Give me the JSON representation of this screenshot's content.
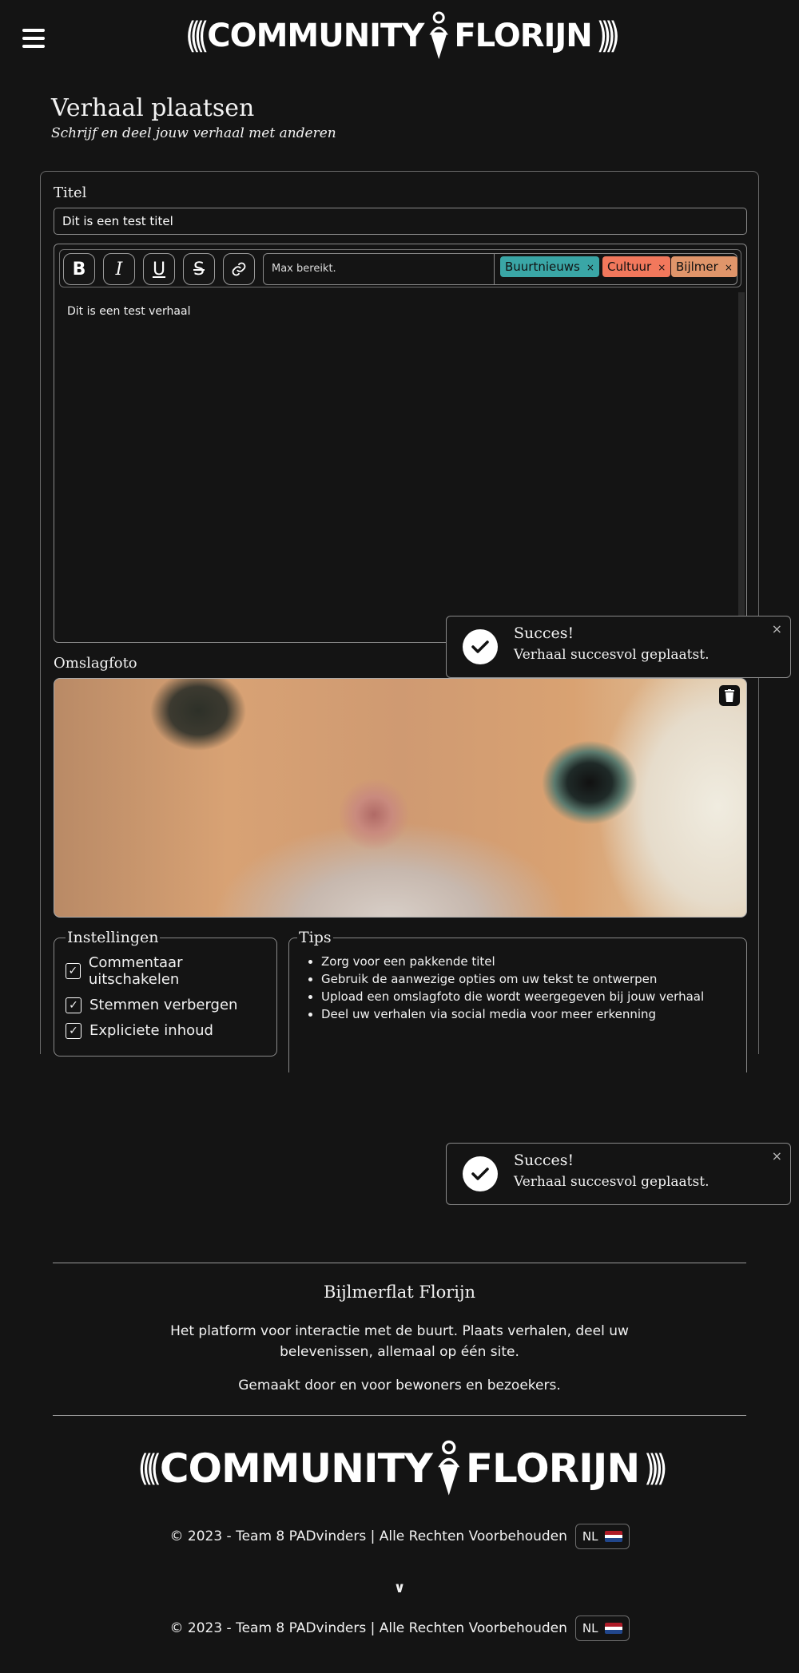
{
  "header": {
    "logo_left": "COMMUNITY",
    "logo_right": "FLORIJN"
  },
  "page": {
    "title": "Verhaal plaatsen",
    "subtitle": "Schrijf en deel jouw verhaal met anderen"
  },
  "form": {
    "title_label": "Titel",
    "title_value": "Dit is een test titel",
    "toolbar": {
      "bold": "B",
      "italic": "I",
      "underline": "U",
      "strike": "S"
    },
    "tags_placeholder": "Max bereikt.",
    "tags": [
      {
        "label": "Buurtnieuws",
        "color": "#3aa6a6"
      },
      {
        "label": "Cultuur",
        "color": "#f2785c"
      },
      {
        "label": "Bijlmer",
        "color": "#e0956a"
      }
    ],
    "tag_remove": "×",
    "body_text": "Dit is een test verhaal",
    "cover_label": "Omslagfoto",
    "settings": {
      "legend": "Instellingen",
      "options": [
        {
          "label": "Commentaar uitschakelen",
          "checked": "✓"
        },
        {
          "label": "Stemmen verbergen",
          "checked": "✓"
        },
        {
          "label": "Expliciete inhoud",
          "checked": "✓"
        }
      ]
    },
    "tips": {
      "legend": "Tips",
      "items": [
        "Zorg voor een pakkende titel",
        "Gebruik de aanwezige opties om uw tekst te ontwerpen",
        "Upload een omslagfoto die wordt weergegeven bij jouw verhaal",
        "Deel uw verhalen via social media voor meer erkenning"
      ]
    }
  },
  "toast": {
    "title": "Succes!",
    "message": "Verhaal succesvol geplaatst.",
    "close": "×"
  },
  "footer": {
    "title": "Bijlmerflat Florijn",
    "description": "Het platform voor interactie met de buurt. Plaats verhalen, deel uw belevenissen, allemaal op één site.",
    "made_by": "Gemaakt door en voor bewoners en bezoekers.",
    "copyright": "© 2023 - Team 8 PADvinders | Alle Rechten Voorbehouden",
    "lang": "NL",
    "chevron": "∨"
  }
}
